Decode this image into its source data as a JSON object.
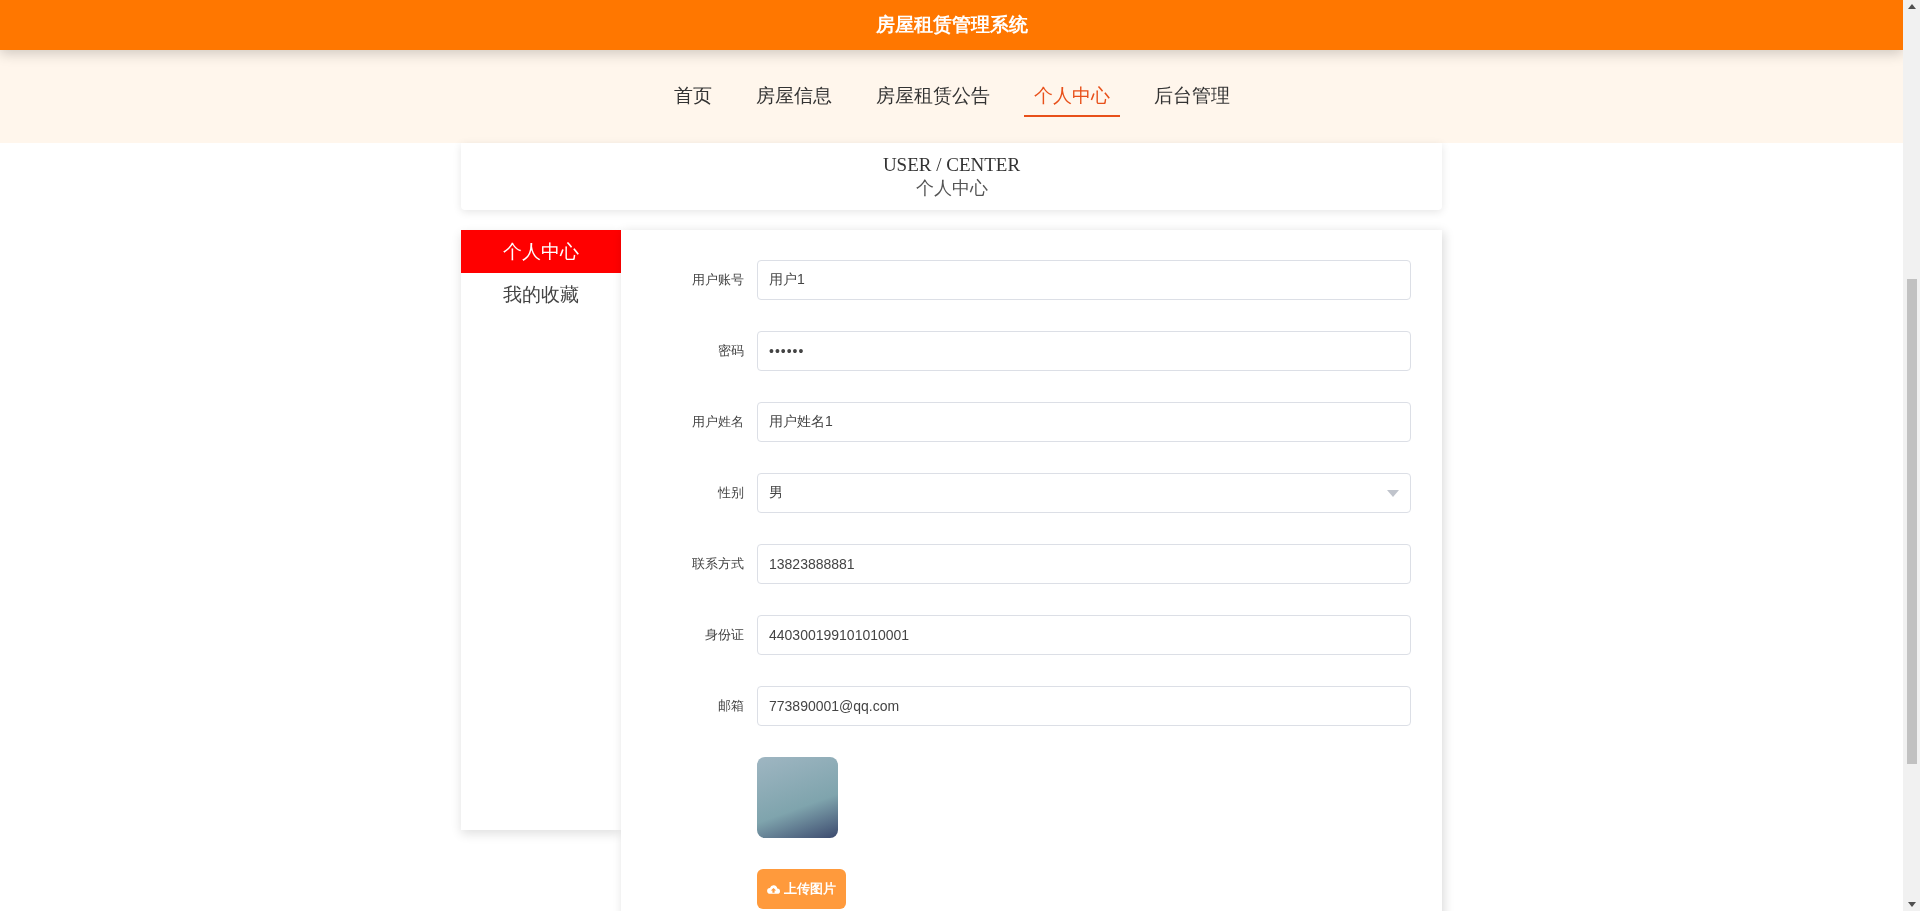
{
  "header": {
    "title": "房屋租赁管理系统"
  },
  "nav": [
    {
      "label": "首页",
      "selected": false
    },
    {
      "label": "房屋信息",
      "selected": false
    },
    {
      "label": "房屋租赁公告",
      "selected": false
    },
    {
      "label": "个人中心",
      "selected": true
    },
    {
      "label": "后台管理",
      "selected": false
    }
  ],
  "section": {
    "title_en": "USER / CENTER",
    "title_zh": "个人中心"
  },
  "sidebar": [
    {
      "label": "个人中心",
      "selected": true
    },
    {
      "label": "我的收藏",
      "selected": false
    }
  ],
  "form": [
    {
      "kind": "text",
      "label": "用户账号",
      "value": "用户1"
    },
    {
      "kind": "password",
      "label": "密码",
      "value": "••••••"
    },
    {
      "kind": "text",
      "label": "用户姓名",
      "value": "用户姓名1"
    },
    {
      "kind": "select",
      "label": "性别",
      "value": "男"
    },
    {
      "kind": "text",
      "label": "联系方式",
      "value": "13823888881"
    },
    {
      "kind": "text",
      "label": "身份证",
      "value": "440300199101010001"
    },
    {
      "kind": "text",
      "label": "邮箱",
      "value": "773890001@qq.com"
    }
  ],
  "upload_button": "上传图片"
}
